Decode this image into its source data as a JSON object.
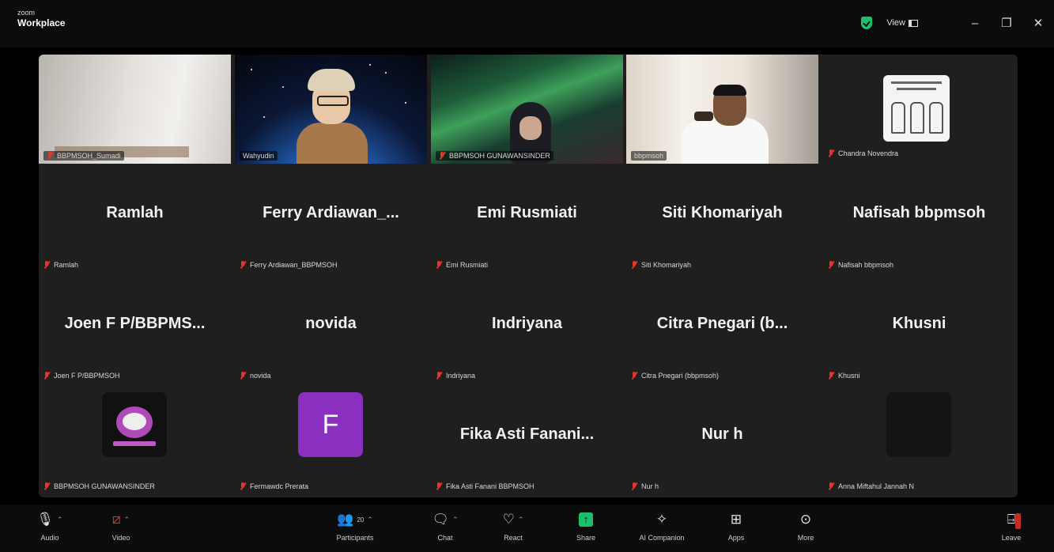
{
  "app": {
    "zoom_label": "zoom",
    "workplace_label": "Workplace"
  },
  "titlebar": {
    "view_label": "View",
    "minimize": "–",
    "restore": "❐",
    "close": "✕"
  },
  "tiles": [
    {
      "name": "BBPMSOH_Sumadi",
      "big": "",
      "muted": true
    },
    {
      "name": "Wahyudin",
      "big": "",
      "muted": false
    },
    {
      "name": "BBPMSOH GUNAWANSINDER",
      "big": "",
      "muted": true
    },
    {
      "name": "bbpmsoh",
      "big": "",
      "muted": false
    },
    {
      "name": "Chandra Novendra",
      "big": "",
      "muted": true
    },
    {
      "name": "Ramlah",
      "big": "Ramlah",
      "muted": true
    },
    {
      "name": "Ferry Ardiawan_BBPMSOH",
      "big": "Ferry Ardiawan_...",
      "muted": true
    },
    {
      "name": "Emi Rusmiati",
      "big": "Emi Rusmiati",
      "muted": true
    },
    {
      "name": "Siti Khomariyah",
      "big": "Siti Khomariyah",
      "muted": true
    },
    {
      "name": "Nafisah bbpmsoh",
      "big": "Nafisah bbpmsoh",
      "muted": true
    },
    {
      "name": "Joen F P/BBPMSOH",
      "big": "Joen F P/BBPMS...",
      "muted": true
    },
    {
      "name": "novida",
      "big": "novida",
      "muted": true
    },
    {
      "name": "Indriyana",
      "big": "Indriyana",
      "muted": true
    },
    {
      "name": "Citra Pnegari (bbpmsoh)",
      "big": "Citra Pnegari (b...",
      "muted": true
    },
    {
      "name": "Khusni",
      "big": "Khusni",
      "muted": true
    },
    {
      "name": "BBPMSOH GUNAWANSINDER",
      "big": "",
      "muted": true
    },
    {
      "name": "Fermawdc Prerata",
      "big": "",
      "muted": true,
      "avatar_letter": "F"
    },
    {
      "name": "Fika Asti Fanani BBPMSOH",
      "big": "Fika Asti Fanani...",
      "muted": true
    },
    {
      "name": "Nur h",
      "big": "Nur h",
      "muted": true
    },
    {
      "name": "Anna Miftahul Jannah N",
      "big": "",
      "muted": true
    }
  ],
  "toolbar": {
    "audio": "Audio",
    "video": "Video",
    "participants": "Participants",
    "participants_count": "20",
    "chat": "Chat",
    "react": "React",
    "share": "Share",
    "ai_companion": "AI Companion",
    "apps": "Apps",
    "more": "More",
    "leave": "Leave"
  },
  "colors": {
    "accent_green": "#19c26a",
    "muted_red": "#e8322c",
    "tile_bg": "#1f1f1f"
  }
}
